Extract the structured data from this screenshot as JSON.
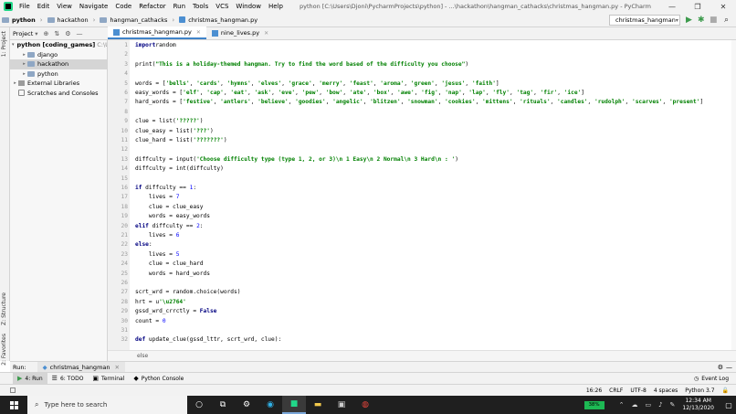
{
  "menu": {
    "items": [
      "File",
      "Edit",
      "View",
      "Navigate",
      "Code",
      "Refactor",
      "Run",
      "Tools",
      "VCS",
      "Window",
      "Help"
    ],
    "window_title": "python [C:\\Users\\Djoni\\PycharmProjects\\python] - ...\\hackathon\\hangman_cathacks\\christmas_hangman.py - PyCharm"
  },
  "breadcrumb": [
    "python",
    "hackathon",
    "hangman_cathacks",
    "christmas_hangman.py"
  ],
  "run_config": "christmas_hangman",
  "project_panel": {
    "title": "Project",
    "tree": [
      {
        "label": "python [coding_games]",
        "extra": "C:\\U",
        "indent": 0,
        "arrow": "▾",
        "icon": "folder"
      },
      {
        "label": "django",
        "indent": 1,
        "arrow": "▸",
        "icon": "folder"
      },
      {
        "label": "hackathon",
        "indent": 1,
        "arrow": "▸",
        "icon": "folder",
        "selected": true
      },
      {
        "label": "python",
        "indent": 1,
        "arrow": "▸",
        "icon": "folder"
      },
      {
        "label": "External Libraries",
        "indent": 0,
        "arrow": "▸",
        "icon": "library"
      },
      {
        "label": "Scratches and Consoles",
        "indent": 0,
        "arrow": "",
        "icon": "scratch"
      }
    ]
  },
  "left_tabs": {
    "project": "1: Project",
    "structure": "Z: Structure",
    "favorites": "2: Favorites"
  },
  "tabs": [
    {
      "label": "christmas_hangman.py",
      "active": true
    },
    {
      "label": "nine_lives.py",
      "active": false
    }
  ],
  "code_lines": [
    [
      [
        "kw",
        "import"
      ],
      [
        "",
        "random"
      ]
    ],
    [],
    [
      [
        "",
        "print("
      ],
      [
        "st",
        "\"This is a holiday-themed hangman. Try to find the word based of the difficulty you choose\""
      ],
      [
        "",
        ")"
      ]
    ],
    [],
    [
      [
        "",
        "words = ["
      ],
      [
        "st",
        "'bells'"
      ],
      [
        "",
        ", "
      ],
      [
        "st",
        "'cards'"
      ],
      [
        "",
        ", "
      ],
      [
        "st",
        "'hymns'"
      ],
      [
        "",
        ", "
      ],
      [
        "st",
        "'elves'"
      ],
      [
        "",
        ", "
      ],
      [
        "st",
        "'grace'"
      ],
      [
        "",
        ", "
      ],
      [
        "st",
        "'merry'"
      ],
      [
        "",
        ", "
      ],
      [
        "st",
        "'feast'"
      ],
      [
        "",
        ", "
      ],
      [
        "st",
        "'aroma'"
      ],
      [
        "",
        ", "
      ],
      [
        "st",
        "'green'"
      ],
      [
        "",
        ", "
      ],
      [
        "st",
        "'jesus'"
      ],
      [
        "",
        ", "
      ],
      [
        "st",
        "'faith'"
      ],
      [
        "",
        "]"
      ]
    ],
    [
      [
        "",
        "easy_words = ["
      ],
      [
        "st",
        "'elf'"
      ],
      [
        "",
        ", "
      ],
      [
        "st",
        "'cap'"
      ],
      [
        "",
        ", "
      ],
      [
        "st",
        "'eat'"
      ],
      [
        "",
        ", "
      ],
      [
        "st",
        "'ask'"
      ],
      [
        "",
        ", "
      ],
      [
        "st",
        "'eve'"
      ],
      [
        "",
        ", "
      ],
      [
        "st",
        "'pew'"
      ],
      [
        "",
        ", "
      ],
      [
        "st",
        "'bow'"
      ],
      [
        "",
        ", "
      ],
      [
        "st",
        "'ate'"
      ],
      [
        "",
        ", "
      ],
      [
        "st",
        "'box'"
      ],
      [
        "",
        ", "
      ],
      [
        "st",
        "'awe'"
      ],
      [
        "",
        ", "
      ],
      [
        "st",
        "'fig'"
      ],
      [
        "",
        ", "
      ],
      [
        "st",
        "'nap'"
      ],
      [
        "",
        ", "
      ],
      [
        "st",
        "'lap'"
      ],
      [
        "",
        ", "
      ],
      [
        "st",
        "'fly'"
      ],
      [
        "",
        ", "
      ],
      [
        "st",
        "'tag'"
      ],
      [
        "",
        ", "
      ],
      [
        "st",
        "'fir'"
      ],
      [
        "",
        ", "
      ],
      [
        "st",
        "'ice'"
      ],
      [
        "",
        "]"
      ]
    ],
    [
      [
        "",
        "hard_words = ["
      ],
      [
        "st",
        "'festive'"
      ],
      [
        "",
        ", "
      ],
      [
        "st",
        "'antlers'"
      ],
      [
        "",
        ", "
      ],
      [
        "st",
        "'believe'"
      ],
      [
        "",
        ", "
      ],
      [
        "st",
        "'goodies'"
      ],
      [
        "",
        ", "
      ],
      [
        "st",
        "'angelic'"
      ],
      [
        "",
        ", "
      ],
      [
        "st",
        "'blitzen'"
      ],
      [
        "",
        ", "
      ],
      [
        "st",
        "'snowman'"
      ],
      [
        "",
        ", "
      ],
      [
        "st",
        "'cookies'"
      ],
      [
        "",
        ", "
      ],
      [
        "st",
        "'mittens'"
      ],
      [
        "",
        ", "
      ],
      [
        "st",
        "'rituals'"
      ],
      [
        "",
        ", "
      ],
      [
        "st",
        "'candles'"
      ],
      [
        "",
        ", "
      ],
      [
        "st",
        "'rudolph'"
      ],
      [
        "",
        ", "
      ],
      [
        "st",
        "'scarves'"
      ],
      [
        "",
        ", "
      ],
      [
        "st",
        "'present'"
      ],
      [
        "",
        "]"
      ]
    ],
    [],
    [
      [
        "",
        "clue = list("
      ],
      [
        "st",
        "'?????'"
      ],
      [
        "",
        ")"
      ]
    ],
    [
      [
        "",
        "clue_easy = list("
      ],
      [
        "st",
        "'???'"
      ],
      [
        "",
        ")"
      ]
    ],
    [
      [
        "",
        "clue_hard = list("
      ],
      [
        "st",
        "'???????'"
      ],
      [
        "",
        ")"
      ]
    ],
    [],
    [
      [
        "",
        "diffculty = input("
      ],
      [
        "st",
        "'Choose difficulty type (type 1, 2, or 3)\\n 1 Easy\\n 2 Normal\\n 3 Hard\\n : '"
      ],
      [
        "",
        ")"
      ]
    ],
    [
      [
        "",
        "diffculty = int(diffculty)"
      ]
    ],
    [],
    [
      [
        "kw",
        "if"
      ],
      [
        "",
        " diffculty == "
      ],
      [
        "num",
        "1"
      ],
      [
        "",
        ":"
      ]
    ],
    [
      [
        "",
        "    lives = "
      ],
      [
        "num",
        "7"
      ]
    ],
    [
      [
        "",
        "    clue = clue_easy"
      ]
    ],
    [
      [
        "",
        "    words = easy_words"
      ]
    ],
    [
      [
        "kw",
        "elif"
      ],
      [
        "",
        " diffculty == "
      ],
      [
        "num",
        "2"
      ],
      [
        "",
        ":"
      ]
    ],
    [
      [
        "",
        "    lives = "
      ],
      [
        "num",
        "6"
      ]
    ],
    [
      [
        "kw",
        "else"
      ],
      [
        "",
        ":"
      ]
    ],
    [
      [
        "",
        "    lives = "
      ],
      [
        "num",
        "5"
      ]
    ],
    [
      [
        "",
        "    clue = clue_hard"
      ]
    ],
    [
      [
        "",
        "    words = hard_words"
      ]
    ],
    [],
    [
      [
        "",
        "scrt_wrd = random.choice(words)"
      ]
    ],
    [
      [
        "",
        "hrt = u"
      ],
      [
        "st",
        "'\\u2764'"
      ]
    ],
    [
      [
        "",
        "gssd_wrd_crrctly = "
      ],
      [
        "kw",
        "False"
      ]
    ],
    [
      [
        "",
        "count = "
      ],
      [
        "num",
        "0"
      ]
    ],
    [],
    [
      [
        "kw",
        "def"
      ],
      [
        "",
        " update_clue(gssd_lttr, scrt_wrd, clue):"
      ]
    ]
  ],
  "context_hint": "else",
  "run_panel": {
    "label": "Run:",
    "tab": "christmas_hangman"
  },
  "tool_windows": [
    {
      "icon": "▶",
      "label": "4: Run",
      "active": true
    },
    {
      "icon": "☰",
      "label": "6: TODO",
      "active": false
    },
    {
      "icon": "▣",
      "label": "Terminal",
      "active": false
    },
    {
      "icon": "◆",
      "label": "Python Console",
      "active": false
    }
  ],
  "event_log": "Event Log",
  "status": {
    "position": "16:26",
    "line_sep": "CRLF",
    "encoding": "UTF-8",
    "indent": "4 spaces",
    "interpreter": "Python 3.7"
  },
  "taskbar": {
    "search_placeholder": "Type here to search",
    "battery": "38%",
    "time": "12:34 AM",
    "date": "12/13/2020"
  },
  "colors": {
    "keyword": "#000080",
    "string": "#008000",
    "number": "#0000ff",
    "accent": "#4083c9"
  }
}
